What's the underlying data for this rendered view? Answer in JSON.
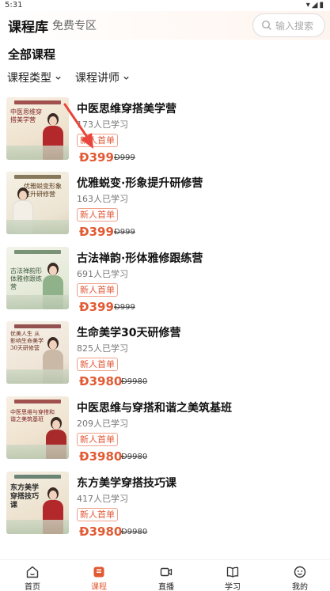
{
  "status_bar": {
    "time": "5:31"
  },
  "header": {
    "tab_main": "课程库",
    "tab_free": "免费专区",
    "search_placeholder": "输入搜索"
  },
  "section_title": "全部课程",
  "filters": {
    "type": "课程类型",
    "teacher": "课程讲师"
  },
  "colors": {
    "accent": "#e25a33",
    "badge_border": "#f0a08a",
    "arrow": "#e8453c"
  },
  "courses": [
    {
      "title": "中医思维穿搭美学营",
      "learners": "173人已学习",
      "badge": "新人首单",
      "price": "Ð399",
      "old_price": "Ð999",
      "thumb_title": "中医思维穿搭美学营"
    },
    {
      "title": "优雅蜕变·形象提升研修营",
      "learners": "163人已学习",
      "badge": "新人首单",
      "price": "Ð399",
      "old_price": "Ð999",
      "thumb_title": "优雅蜕变形象提升研修营"
    },
    {
      "title": "古法禅韵·形体雅修跟练营",
      "learners": "691人已学习",
      "badge": "新人首单",
      "price": "Ð399",
      "old_price": "Ð999",
      "thumb_title": "古法禅韵形体雅修跟练营"
    },
    {
      "title": "生命美学30天研修营",
      "learners": "825人已学习",
      "badge": "新人首单",
      "price": "Ð3980",
      "old_price": "Ð9980",
      "thumb_title": "优美人生 从影响生命美学30天研修营"
    },
    {
      "title": "中医思维与穿搭和谐之美筑基班",
      "learners": "209人已学习",
      "badge": "新人首单",
      "price": "Ð3980",
      "old_price": "Ð9980",
      "thumb_title": "中医思维与穿搭和谐之美筑基班"
    },
    {
      "title": "东方美学穿搭技巧课",
      "learners": "417人已学习",
      "badge": "新人首单",
      "price": "Ð3980",
      "old_price": "Ð9980",
      "thumb_title": "东方美学穿搭技巧课"
    }
  ],
  "tabbar": [
    {
      "label": "首页",
      "icon": "home-icon"
    },
    {
      "label": "课程",
      "icon": "course-icon"
    },
    {
      "label": "直播",
      "icon": "live-icon"
    },
    {
      "label": "学习",
      "icon": "book-icon"
    },
    {
      "label": "我的",
      "icon": "profile-icon"
    }
  ]
}
